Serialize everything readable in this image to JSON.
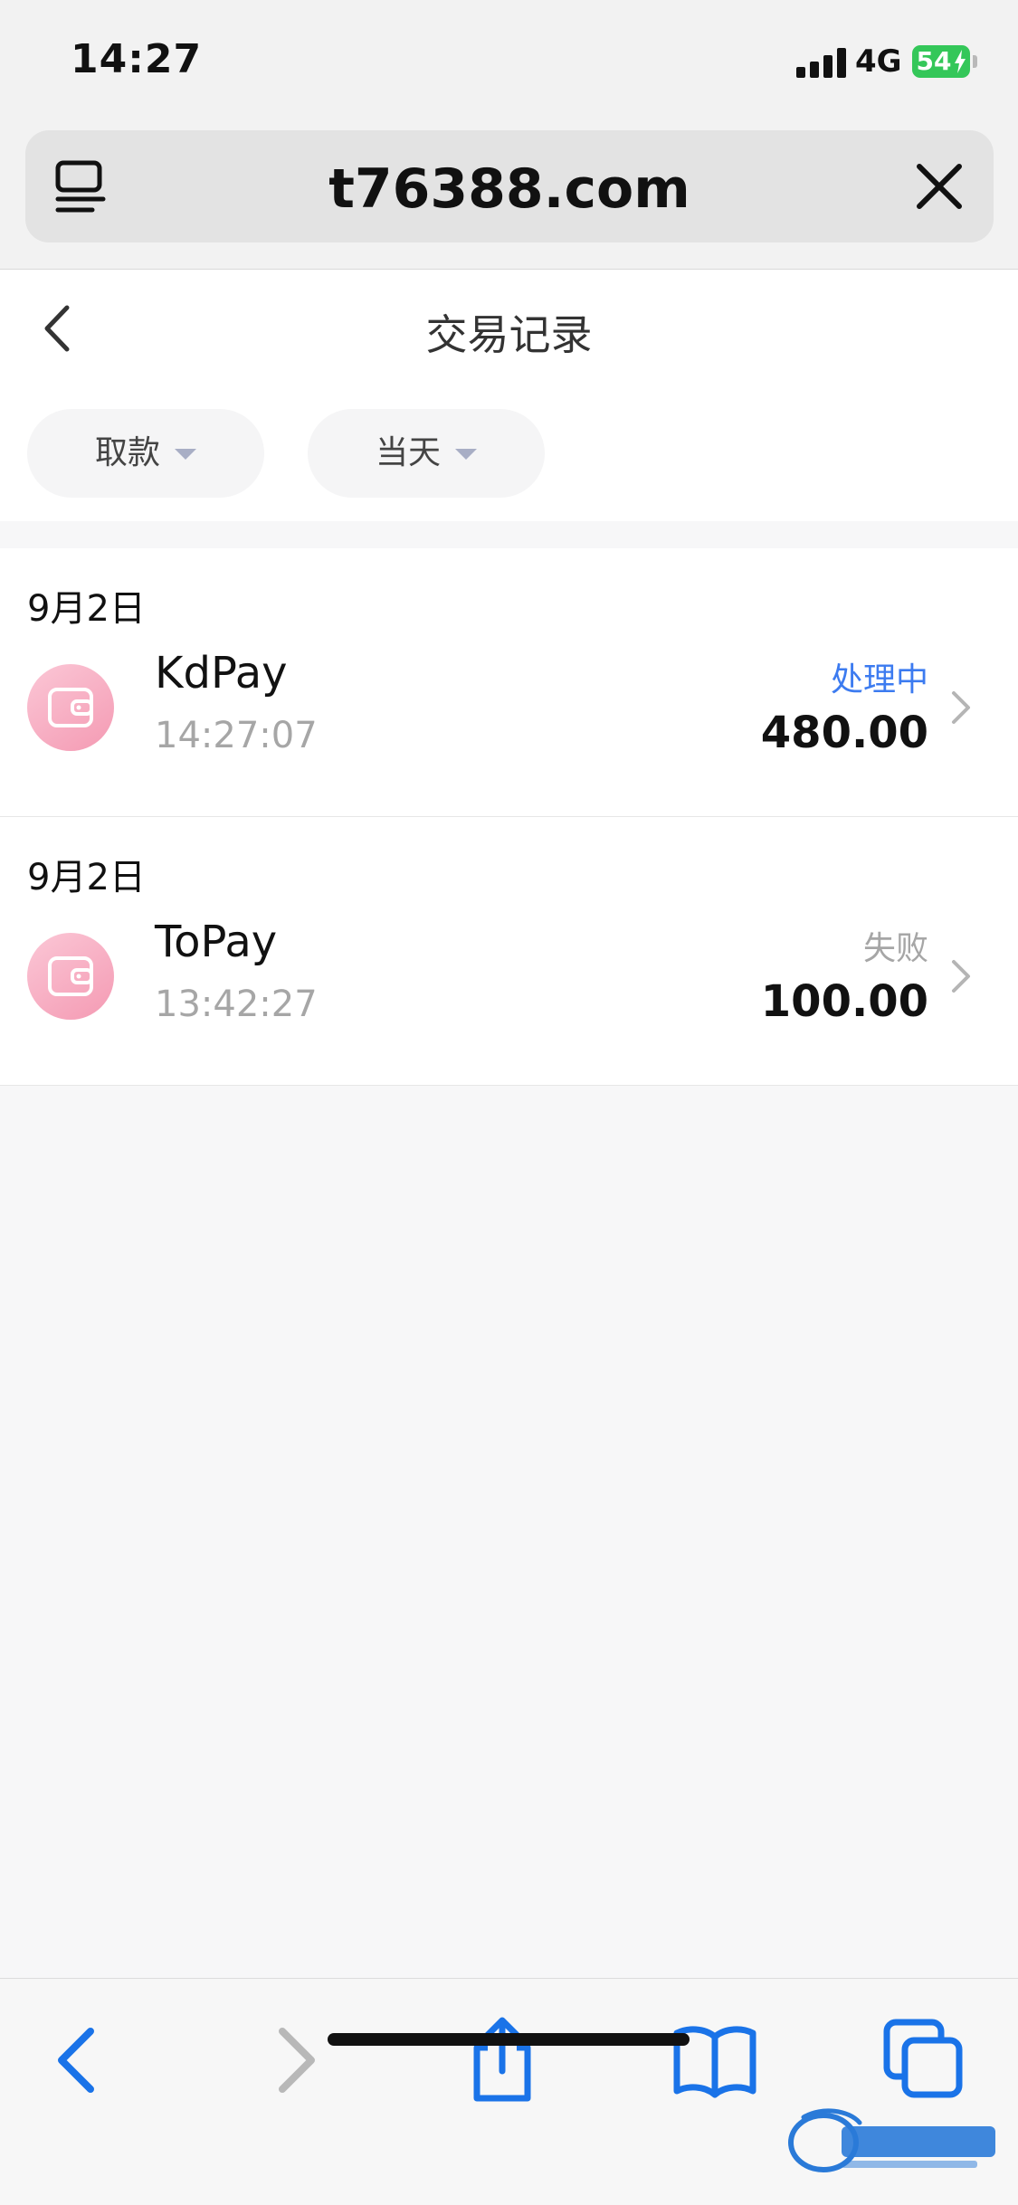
{
  "status_bar": {
    "time": "14:27",
    "network": "4G",
    "battery_percent": "54"
  },
  "browser": {
    "url": "t76388.com",
    "tab_icon": "tab-overview-icon",
    "close_icon": "close-icon"
  },
  "page": {
    "title": "交易记录",
    "back_icon": "chevron-left-icon"
  },
  "filters": {
    "type_label": "取款",
    "date_label": "当天"
  },
  "transactions": [
    {
      "date": "9月2日",
      "name": "KdPay",
      "time": "14:27:07",
      "status": "处理中",
      "amount": "480.00",
      "status_color": "#3c7bf0"
    },
    {
      "date": "9月2日",
      "name": "ToPay",
      "time": "13:42:27",
      "status": "失败",
      "amount": "100.00",
      "status_color": "#a6a6a6"
    }
  ],
  "toolbar": {
    "icons": [
      "back-icon",
      "forward-icon",
      "share-icon",
      "bookmarks-icon",
      "tabs-icon"
    ]
  },
  "colors": {
    "accent_blue": "#1a73e8",
    "wallet_pink": "#f49ab3",
    "battery_green": "#34c759"
  }
}
